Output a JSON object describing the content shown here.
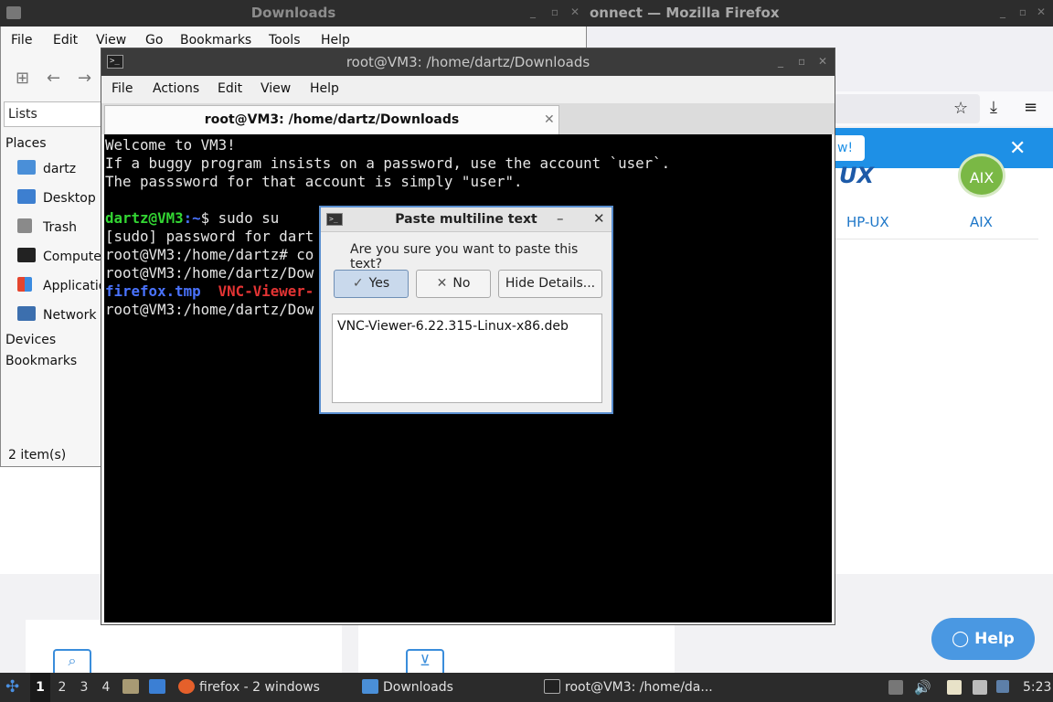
{
  "file_manager": {
    "title": "Downloads",
    "menu": [
      "File",
      "Edit",
      "View",
      "Go",
      "Bookmarks",
      "Tools",
      "Help"
    ],
    "side_tab": "Lists",
    "places_heading": "Places",
    "places": [
      "dartz",
      "Desktop",
      "Trash",
      "Computer",
      "Applications",
      "Network"
    ],
    "devices_heading": "Devices",
    "bookmarks_heading": "Bookmarks",
    "status": "2 item(s)"
  },
  "firefox": {
    "title": "onnect — Mozilla Firefox",
    "banner_text": "w!",
    "os_labels": [
      "HP-UX",
      "AIX"
    ],
    "logo_text": [
      "UX",
      "AIX"
    ],
    "help_button": "Help"
  },
  "terminal": {
    "title": "root@VM3: /home/dartz/Downloads",
    "menu": [
      "File",
      "Actions",
      "Edit",
      "View",
      "Help"
    ],
    "tab_title": "root@VM3: /home/dartz/Downloads",
    "lines": {
      "l1": "Welcome to VM3!",
      "l2": "If a buggy program insists on a password, use the account `user`.",
      "l3": "The passsword for that account is simply \"user\".",
      "l5_user": "dartz@VM3",
      "l5_path": ":~",
      "l5_cmd": "$ sudo su",
      "l6": "[sudo] password for dart",
      "l7": "root@VM3:/home/dartz# co",
      "l8": "root@VM3:/home/dartz/Dow",
      "l9_file1": "firefox.tmp",
      "l9_file2": "VNC-Viewer-",
      "l10": "root@VM3:/home/dartz/Dow"
    }
  },
  "dialog": {
    "title": "Paste multiline text",
    "question": "Are you sure you want to paste this text?",
    "yes": "Yes",
    "no": "No",
    "details": "Hide Details...",
    "text": "VNC-Viewer-6.22.315-Linux-x86.deb"
  },
  "taskbar": {
    "workspaces": [
      "1",
      "2",
      "3",
      "4"
    ],
    "firefox": "firefox - 2 windows",
    "downloads": "Downloads",
    "terminal": "root@VM3: /home/da...",
    "clock": "5:23"
  },
  "colors": {
    "accent": "#1e90e6",
    "terminal_user": "#33d633",
    "terminal_path": "#4a73ff",
    "terminal_deb": "#e43434"
  }
}
